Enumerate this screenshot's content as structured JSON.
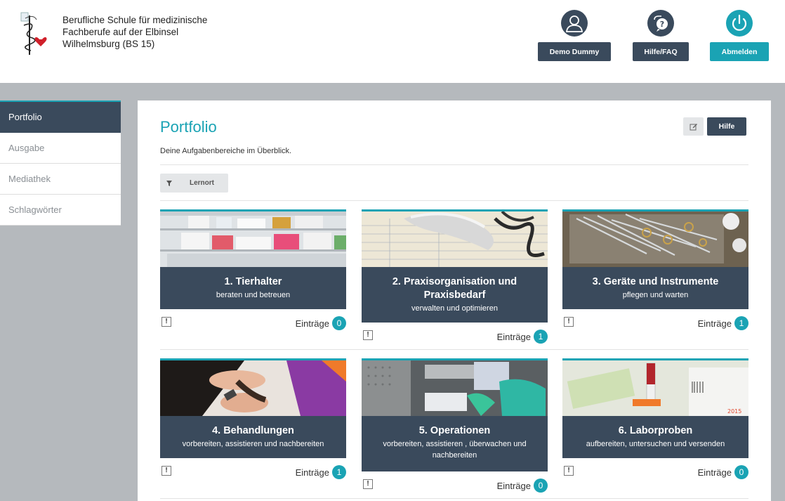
{
  "header": {
    "school_lines": [
      "Berufliche Schule für medizinische",
      "Fachberufe auf der Elbinsel",
      "Wilhelmsburg (BS 15)"
    ],
    "buttons": [
      {
        "label": "Demo Dummy",
        "icon": "user-icon",
        "color": "#3a4a5c"
      },
      {
        "label": "Hilfe/FAQ",
        "icon": "help-chat-icon",
        "color": "#3a4a5c"
      },
      {
        "label": "Abmelden",
        "icon": "power-icon",
        "color": "#1aa3b4"
      }
    ]
  },
  "sidebar": {
    "items": [
      {
        "label": "Portfolio",
        "active": true
      },
      {
        "label": "Ausgabe",
        "active": false
      },
      {
        "label": "Mediathek",
        "active": false
      },
      {
        "label": "Schlagwörter",
        "active": false
      }
    ]
  },
  "main": {
    "title": "Portfolio",
    "subtitle": "Deine Aufgabenbereiche im Überblick.",
    "edit_icon": "edit-icon",
    "help_label": "Hilfe",
    "filter_label": "Lernort",
    "filter_icon": "filter-icon"
  },
  "cards": [
    {
      "title": "1. Tierhalter",
      "subtitle": "beraten und betreuen",
      "entries_label": "Einträge",
      "count": "0",
      "image": "pharmacy-shelf"
    },
    {
      "title": "2. Praxisorganisation und Praxisbedarf",
      "subtitle": "verwalten und optimieren",
      "entries_label": "Einträge",
      "count": "1",
      "image": "telephone-desk"
    },
    {
      "title": "3. Geräte und Instrumente",
      "subtitle": "pflegen und warten",
      "entries_label": "Einträge",
      "count": "1",
      "image": "surgical-instruments"
    },
    {
      "title": "4. Behandlungen",
      "subtitle": "vorbereiten, assistieren und nachbereiten",
      "entries_label": "Einträge",
      "count": "1",
      "image": "dog-paw-care"
    },
    {
      "title": "5. Operationen",
      "subtitle": "vorbereiten, assistieren , überwachen und nachbereiten",
      "entries_label": "Einträge",
      "count": "0",
      "image": "operating-room"
    },
    {
      "title": "6. Laborproben",
      "subtitle": "aufbereiten, untersuchen und versenden",
      "entries_label": "Einträge",
      "count": "0",
      "image": "lab-tubes"
    }
  ],
  "colors": {
    "accent": "#1aa3b4",
    "dark": "#3a4a5c",
    "background": "#b5b9bd"
  }
}
